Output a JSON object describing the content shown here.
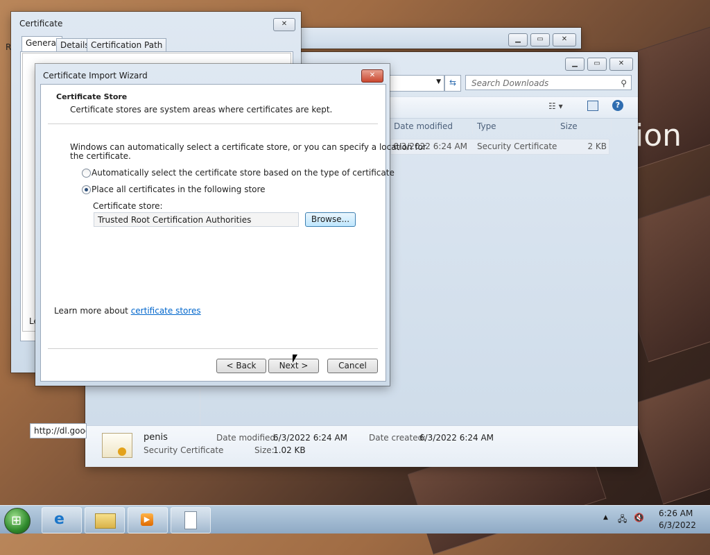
{
  "desktop": {
    "partial_text": "ion"
  },
  "certificate_dialog": {
    "title": "Certificate",
    "close_glyph": "✕",
    "tabs": [
      "General",
      "Details",
      "Certification Path"
    ],
    "partial_left_text": "R",
    "bottom_partial": "Le"
  },
  "explorer": {
    "search_placeholder": "Search Downloads",
    "columns": {
      "date_modified": "Date modified",
      "type": "Type",
      "size": "Size"
    },
    "rows": [
      {
        "date_modified": "6/3/2022 6:24 AM",
        "type": "Security Certificate",
        "size": "2 KB"
      }
    ],
    "status_url": "http://dl.goog",
    "details": {
      "name": "penis",
      "type": "Security Certificate",
      "date_modified_label": "Date modified:",
      "date_modified": "6/3/2022 6:24 AM",
      "date_created_label": "Date created:",
      "date_created": "6/3/2022 6:24 AM",
      "size_label": "Size:",
      "size": "1.02 KB"
    }
  },
  "wizard": {
    "title": "Certificate Import Wizard",
    "header_title": "Certificate Store",
    "header_subtitle": "Certificate stores are system areas where certificates are kept.",
    "intro_line1": "Windows can automatically select a certificate store, or you can specify a location for",
    "intro_line2": "the certificate.",
    "radio_auto": "Automatically select the certificate store based on the type of certificate",
    "radio_place": "Place all certificates in the following store",
    "store_label": "Certificate store:",
    "store_value": "Trusted Root Certification Authorities",
    "browse": "Browse...",
    "learn_more_prefix": "Learn more about ",
    "learn_more_link": "certificate stores",
    "back": "< Back",
    "next": "Next >",
    "cancel": "Cancel",
    "close_glyph": "✕"
  },
  "taskbar": {
    "time": "6:26 AM",
    "date": "6/3/2022"
  }
}
